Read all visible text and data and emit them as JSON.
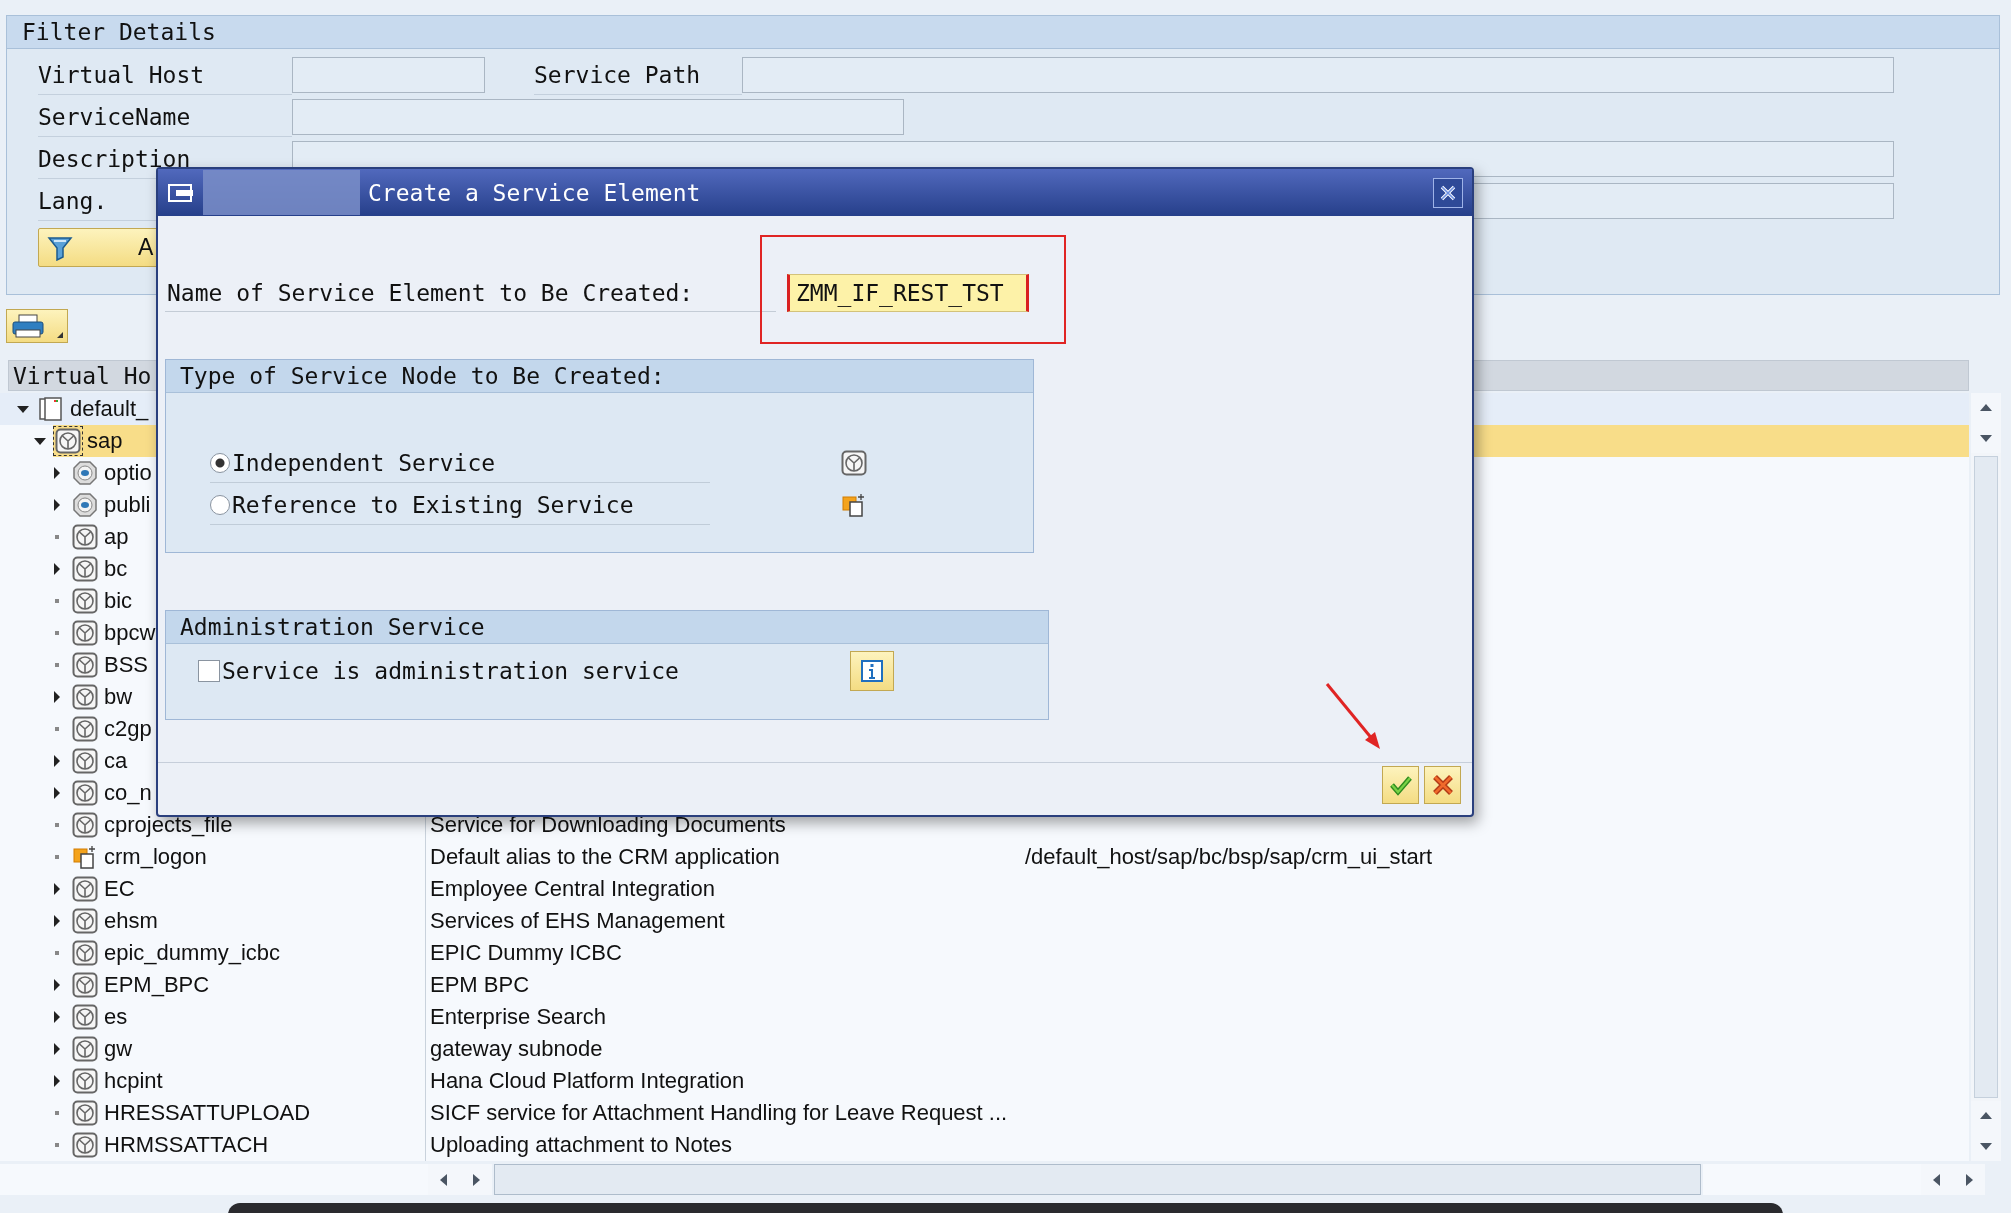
{
  "filter": {
    "title": "Filter Details",
    "rows": [
      {
        "fields": [
          {
            "label": "Virtual Host",
            "kind": "short"
          },
          {
            "label": "Service Path",
            "kind": "long"
          }
        ]
      },
      {
        "fields": [
          {
            "label": "ServiceName",
            "kind": "medium"
          }
        ]
      },
      {
        "fields": [
          {
            "label": "Description",
            "kind": "full"
          }
        ]
      },
      {
        "fields": [
          {
            "label": "Lang.",
            "kind": "full"
          }
        ]
      }
    ],
    "apply_button": {
      "label": "A"
    }
  },
  "tree": {
    "columns": [
      "Virtual Ho"
    ],
    "rows": [
      {
        "name": "default_",
        "kind": "host",
        "has_children": true,
        "expanded": true,
        "selected": false,
        "children": [
          {
            "name": "sap",
            "kind": "service",
            "has_children": true,
            "expanded": true,
            "selected": true,
            "children": [
              {
                "name": "optio",
                "kind": "external",
                "has_children": true,
                "expanded": false,
                "selected": false
              },
              {
                "name": "publi",
                "kind": "external",
                "has_children": true,
                "expanded": false,
                "selected": false
              },
              {
                "name": "ap",
                "kind": "service",
                "has_children": false,
                "selected": false
              },
              {
                "name": "bc",
                "kind": "service",
                "has_children": true,
                "expanded": false,
                "selected": false
              },
              {
                "name": "bic",
                "kind": "service",
                "has_children": false,
                "selected": false
              },
              {
                "name": "bpcw",
                "kind": "service",
                "has_children": false,
                "selected": false
              },
              {
                "name": "BSS",
                "kind": "service",
                "has_children": false,
                "selected": false
              },
              {
                "name": "bw",
                "kind": "service",
                "has_children": true,
                "expanded": false,
                "selected": false
              },
              {
                "name": "c2gp",
                "kind": "service",
                "has_children": false,
                "selected": false
              },
              {
                "name": "ca",
                "kind": "service",
                "has_children": true,
                "expanded": false,
                "selected": false
              },
              {
                "name": "co_n",
                "kind": "service",
                "has_children": true,
                "expanded": false,
                "selected": false
              },
              {
                "name": "cprojects_file",
                "kind": "service",
                "has_children": false,
                "selected": false,
                "description": "Service for Downloading Documents"
              },
              {
                "name": "crm_logon",
                "kind": "alias",
                "has_children": false,
                "selected": false,
                "description": "Default alias to the CRM application",
                "column_3": "/default_host/sap/bc/bsp/sap/crm_ui_start"
              },
              {
                "name": "EC",
                "kind": "service",
                "has_children": true,
                "expanded": false,
                "selected": false,
                "description": "Employee Central Integration"
              },
              {
                "name": "ehsm",
                "kind": "service",
                "has_children": true,
                "expanded": false,
                "selected": false,
                "description": "Services of EHS Management"
              },
              {
                "name": "epic_dummy_icbc",
                "kind": "service",
                "has_children": false,
                "selected": false,
                "description": "EPIC Dummy ICBC"
              },
              {
                "name": "EPM_BPC",
                "kind": "service",
                "has_children": true,
                "expanded": false,
                "selected": false,
                "description": "EPM BPC"
              },
              {
                "name": "es",
                "kind": "service",
                "has_children": true,
                "expanded": false,
                "selected": false,
                "description": "Enterprise Search"
              },
              {
                "name": "gw",
                "kind": "service",
                "has_children": true,
                "expanded": false,
                "selected": false,
                "description": "gateway subnode"
              },
              {
                "name": "hcpint",
                "kind": "service",
                "has_children": true,
                "expanded": false,
                "selected": false,
                "description": "Hana Cloud Platform Integration"
              },
              {
                "name": "HRESSATTUPLOAD",
                "kind": "service",
                "has_children": false,
                "selected": false,
                "description": "SICF service for Attachment Handling for Leave Request ..."
              },
              {
                "name": "HRMSSATTACH",
                "kind": "service",
                "has_children": false,
                "selected": false,
                "description": "Uploading attachment to Notes"
              }
            ]
          }
        ]
      }
    ]
  },
  "dialog": {
    "title": "Create a Service Element",
    "name_label": "Name of Service Element to Be Created:",
    "name_value": "ZMM_IF_REST_TST",
    "type_group": {
      "title": "Type of Service Node to Be Created:",
      "options": [
        {
          "label": "Independent Service",
          "selected": true,
          "kind": "service"
        },
        {
          "label": "Reference to Existing Service",
          "selected": false,
          "kind": "alias"
        }
      ]
    },
    "admin_group": {
      "title": "Administration Service",
      "checkbox": {
        "label": "Service is administration service",
        "checked": false
      }
    },
    "buttons": [
      {
        "kind": "confirm"
      },
      {
        "kind": "cancel"
      }
    ]
  }
}
